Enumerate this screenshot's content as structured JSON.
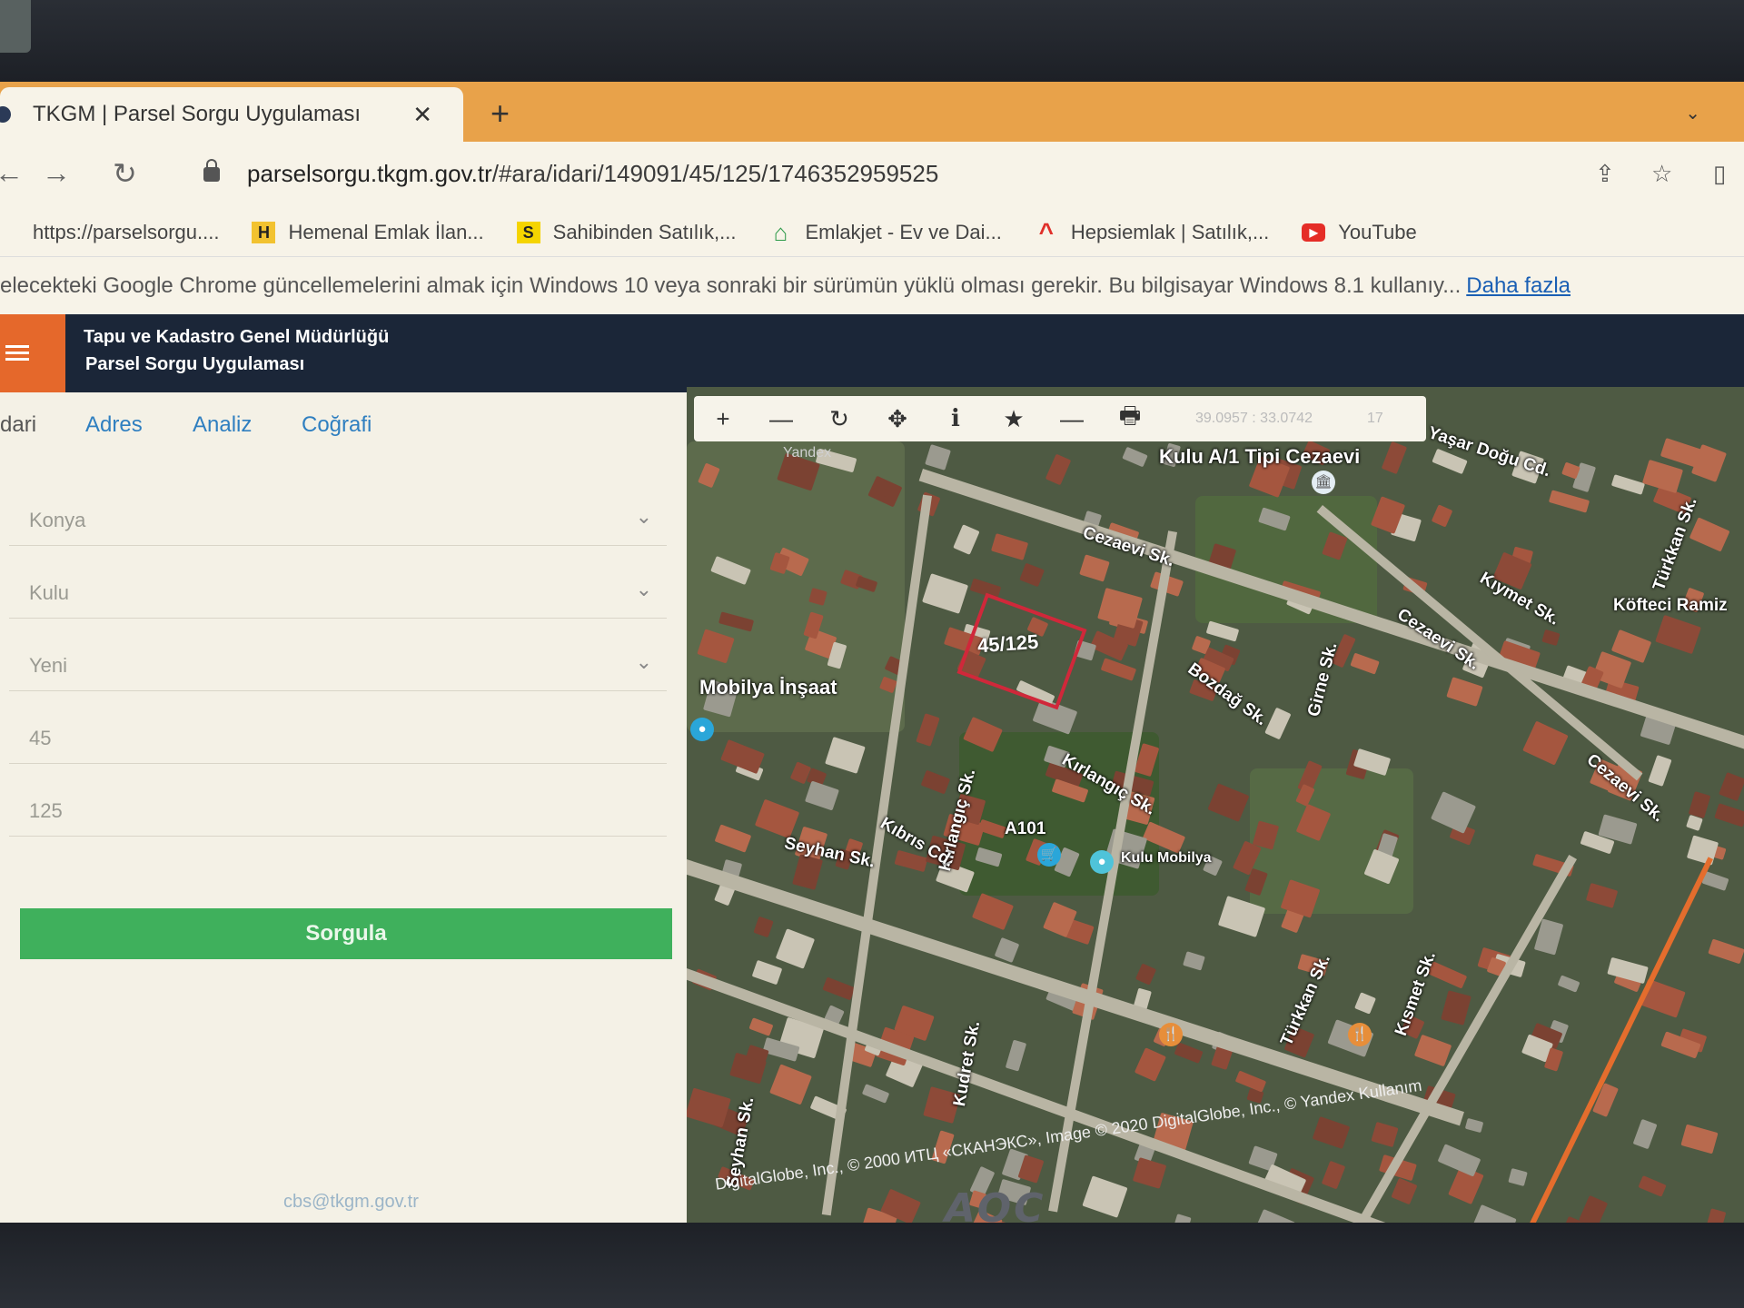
{
  "browser": {
    "tab_title": "TKGM | Parsel Sorgu Uygulaması",
    "tab_close": "✕",
    "new_tab": "+",
    "url_host": "parselsorgu.tkgm.gov.tr",
    "url_path": "/#ara/idari/149091/45/125/1746352959525",
    "bookmarks": [
      {
        "label": "https://parselsorgu....",
        "icon": "globe-icon",
        "badge": "",
        "color": "#999999"
      },
      {
        "label": "Hemenal Emlak İlan...",
        "icon": "h-logo-icon",
        "badge": "H",
        "color": "#f2c230"
      },
      {
        "label": "Sahibinden Satılık,...",
        "icon": "s-logo-icon",
        "badge": "S",
        "color": "#f5d400"
      },
      {
        "label": "Emlakjet - Ev ve Dai...",
        "icon": "house-icon",
        "badge": "⌂",
        "color": "#2e9a4a"
      },
      {
        "label": "Hepsiemlak | Satılık,...",
        "icon": "roof-icon",
        "badge": "^",
        "color": "#e0302a"
      },
      {
        "label": "YouTube",
        "icon": "youtube-icon",
        "badge": "▶",
        "color": "#e52d27"
      }
    ],
    "infobar_text": "elecekteki Google Chrome güncellemelerini almak için Windows 10 veya sonraki bir sürümün yüklü olması gerekir. Bu bilgisayar Windows 8.1 kullanıy...",
    "infobar_link": "Daha fazla"
  },
  "app": {
    "title_line1": "Tapu ve Kadastro Genel Müdürlüğü",
    "title_line2": "Parsel Sorgu Uygulaması"
  },
  "panel": {
    "tabs": [
      "dari",
      "Adres",
      "Analiz",
      "Coğrafi"
    ],
    "fields": [
      {
        "value": "Konya",
        "dropdown": true
      },
      {
        "value": "Kulu",
        "dropdown": true
      },
      {
        "value": "Yeni",
        "dropdown": true
      },
      {
        "value": "45",
        "dropdown": false
      },
      {
        "value": "125",
        "dropdown": false
      }
    ],
    "submit_label": "Sorgula",
    "footer_email": "cbs@tkgm.gov.tr"
  },
  "map": {
    "tools": [
      {
        "name": "zoom-in-icon",
        "glyph": "+"
      },
      {
        "name": "zoom-out-icon",
        "glyph": "—"
      },
      {
        "name": "refresh-icon",
        "glyph": "↻"
      },
      {
        "name": "pan-icon",
        "glyph": "✥"
      },
      {
        "name": "info-icon",
        "glyph": "i"
      },
      {
        "name": "star-icon",
        "glyph": "★"
      },
      {
        "name": "measure-icon",
        "glyph": "—"
      },
      {
        "name": "print-icon",
        "glyph": "🖶"
      }
    ],
    "coords": "39.0957 : 33.0742",
    "zoom": "17",
    "parcel_label": "45/125",
    "parcel_color": "#d0283a",
    "labels": [
      "Kulu A/1 Tipi Cezaevi",
      "Cezaevi Sk.",
      "Yaşar Doğu Cd.",
      "Kıymet Sk.",
      "Köfteci Ramiz",
      "Türkkan Sk.",
      "Bozdağ Sk.",
      "Girne Sk.",
      "Cezaevi Sk.",
      "Mobilya İnşaat",
      "Kırlangıç Sk.",
      "Kırlangıç Sk.",
      "Kıbrıs Cd.",
      "Seyhan Sk.",
      "A101",
      "Kulu Mobilya",
      "Türkkan Sk.",
      "Kısmet Sk.",
      "Cezaevi Sk.",
      "Kudret Sk.",
      "Seyhan Sk.",
      "Yandex"
    ],
    "copyright": "DigitalGlobe, Inc., © 2000 ИТЦ «СКАНЭКС», Image © 2020 DigitalGlobe, Inc., © Yandex Kullanım"
  },
  "taskbar": {
    "items": [
      "start-icon",
      "ie-icon",
      "file-explorer-icon",
      "store-icon",
      "edge-icon",
      "chrome-icon"
    ]
  },
  "monitor": {
    "brand": "AOC"
  }
}
